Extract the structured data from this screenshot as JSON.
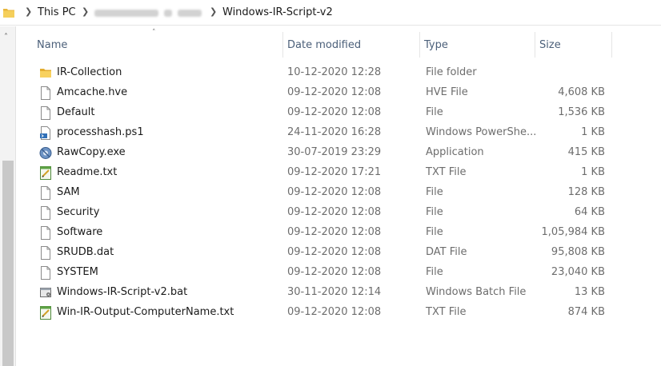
{
  "breadcrumb": {
    "root": "This PC",
    "current": "Windows-IR-Script-v2"
  },
  "columns": {
    "name": "Name",
    "date": "Date modified",
    "type": "Type",
    "size": "Size"
  },
  "files": [
    {
      "icon": "folder-icon",
      "name": "IR-Collection",
      "date": "10-12-2020 12:28",
      "type": "File folder",
      "size": ""
    },
    {
      "icon": "file-icon",
      "name": "Amcache.hve",
      "date": "09-12-2020 12:08",
      "type": "HVE File",
      "size": "4,608 KB"
    },
    {
      "icon": "file-icon",
      "name": "Default",
      "date": "09-12-2020 12:08",
      "type": "File",
      "size": "1,536 KB"
    },
    {
      "icon": "powershell-script-icon",
      "name": "processhash.ps1",
      "date": "24-11-2020 16:28",
      "type": "Windows PowerShe...",
      "size": "1 KB"
    },
    {
      "icon": "application-icon",
      "name": "RawCopy.exe",
      "date": "30-07-2019 23:29",
      "type": "Application",
      "size": "415 KB"
    },
    {
      "icon": "text-file-icon",
      "name": "Readme.txt",
      "date": "09-12-2020 17:21",
      "type": "TXT File",
      "size": "1 KB"
    },
    {
      "icon": "file-icon",
      "name": "SAM",
      "date": "09-12-2020 12:08",
      "type": "File",
      "size": "128 KB"
    },
    {
      "icon": "file-icon",
      "name": "Security",
      "date": "09-12-2020 12:08",
      "type": "File",
      "size": "64 KB"
    },
    {
      "icon": "file-icon",
      "name": "Software",
      "date": "09-12-2020 12:08",
      "type": "File",
      "size": "1,05,984 KB"
    },
    {
      "icon": "file-icon",
      "name": "SRUDB.dat",
      "date": "09-12-2020 12:08",
      "type": "DAT File",
      "size": "95,808 KB"
    },
    {
      "icon": "file-icon",
      "name": "SYSTEM",
      "date": "09-12-2020 12:08",
      "type": "File",
      "size": "23,040 KB"
    },
    {
      "icon": "batch-file-icon",
      "name": "Windows-IR-Script-v2.bat",
      "date": "30-11-2020 12:14",
      "type": "Windows Batch File",
      "size": "13 KB"
    },
    {
      "icon": "text-file-icon",
      "name": "Win-IR-Output-ComputerName.txt",
      "date": "09-12-2020 12:08",
      "type": "TXT File",
      "size": "874 KB"
    }
  ]
}
